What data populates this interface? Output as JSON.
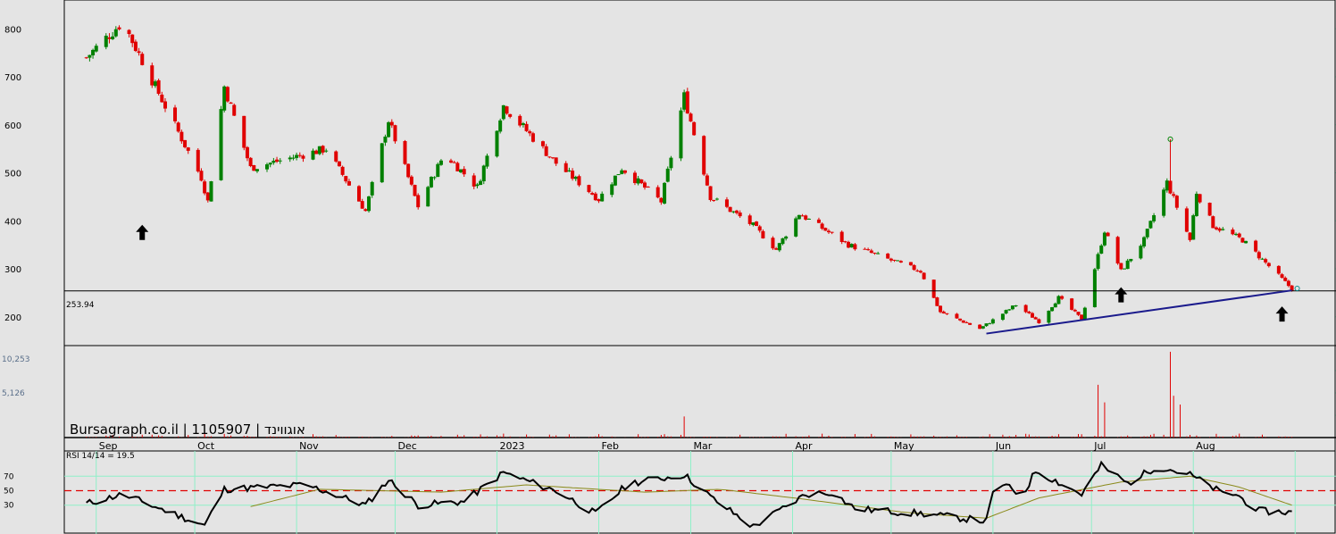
{
  "chart_data": {
    "type": "candlestick",
    "watermark": "Bursagraph.co.il | 1105907 | אוגווינד",
    "x_month_labels": [
      "Sep",
      "Oct",
      "Nov",
      "Dec",
      "2023",
      "Feb",
      "Mar",
      "Apr",
      "May",
      "Jun",
      "Jul",
      "Aug"
    ],
    "price_axis": {
      "ticks": [
        800,
        700,
        600,
        500,
        400,
        300,
        200
      ],
      "range": [
        140,
        860
      ]
    },
    "price_level_label": "253.94",
    "price_level": 253.94,
    "volume_axis": {
      "ticks": [
        "10,253",
        "5,126"
      ]
    },
    "rsi_label": "RSI 14/14 = 19.5",
    "rsi_axis": {
      "ticks": [
        70,
        50,
        30
      ],
      "reference_level": 50
    },
    "colors": {
      "up": "#008000",
      "down": "#e00000",
      "grid": "#8ff0c8",
      "trendline": "#1a1a8c",
      "rsi_ref": "#e00000",
      "rsi_line": "#000000",
      "rsi_signal": "#8a8a1a",
      "volume": "#e00000"
    },
    "trendline": {
      "from": {
        "date": "2023-05-30",
        "price": 165
      },
      "to": {
        "date": "2023-08-31",
        "price": 255
      }
    },
    "arrows": [
      {
        "date": "2022-09-15",
        "price": 375
      },
      {
        "date": "2023-07-10",
        "price": 245
      },
      {
        "date": "2023-08-28",
        "price": 205
      }
    ],
    "series": {
      "close_anchors": [
        {
          "date": "2022-08-29",
          "price": 740
        },
        {
          "date": "2022-09-09",
          "price": 815
        },
        {
          "date": "2022-10-03",
          "price": 490
        },
        {
          "date": "2022-10-05",
          "price": 440
        },
        {
          "date": "2022-10-10",
          "price": 680
        },
        {
          "date": "2022-10-18",
          "price": 510
        },
        {
          "date": "2022-11-10",
          "price": 550
        },
        {
          "date": "2022-11-22",
          "price": 420
        },
        {
          "date": "2022-11-29",
          "price": 610
        },
        {
          "date": "2022-12-08",
          "price": 430
        },
        {
          "date": "2022-12-16",
          "price": 540
        },
        {
          "date": "2022-12-26",
          "price": 470
        },
        {
          "date": "2023-01-03",
          "price": 640
        },
        {
          "date": "2023-01-19",
          "price": 520
        },
        {
          "date": "2023-02-01",
          "price": 445
        },
        {
          "date": "2023-02-08",
          "price": 510
        },
        {
          "date": "2023-02-20",
          "price": 440
        },
        {
          "date": "2023-02-27",
          "price": 660
        },
        {
          "date": "2023-03-07",
          "price": 450
        },
        {
          "date": "2023-03-20",
          "price": 390
        },
        {
          "date": "2023-03-27",
          "price": 340
        },
        {
          "date": "2023-04-03",
          "price": 415
        },
        {
          "date": "2023-04-18",
          "price": 350
        },
        {
          "date": "2023-05-10",
          "price": 295
        },
        {
          "date": "2023-05-16",
          "price": 210
        },
        {
          "date": "2023-05-28",
          "price": 175
        },
        {
          "date": "2023-06-08",
          "price": 225
        },
        {
          "date": "2023-06-15",
          "price": 190
        },
        {
          "date": "2023-06-21",
          "price": 240
        },
        {
          "date": "2023-06-28",
          "price": 195
        },
        {
          "date": "2023-07-05",
          "price": 380
        },
        {
          "date": "2023-07-10",
          "price": 295
        },
        {
          "date": "2023-07-17",
          "price": 360
        },
        {
          "date": "2023-07-24",
          "price": 480
        },
        {
          "date": "2023-07-31",
          "price": 360
        },
        {
          "date": "2023-08-02",
          "price": 460
        },
        {
          "date": "2023-08-07",
          "price": 390
        },
        {
          "date": "2023-08-16",
          "price": 360
        },
        {
          "date": "2023-08-31",
          "price": 258
        }
      ],
      "spike_high": {
        "date": "2023-07-25",
        "price": 570
      },
      "volume_spikes": [
        {
          "date": "2023-02-27",
          "volume": 4800
        },
        {
          "date": "2023-07-03",
          "volume": 12000
        },
        {
          "date": "2023-07-05",
          "volume": 8000
        },
        {
          "date": "2023-07-25",
          "volume": 19500
        },
        {
          "date": "2023-07-26",
          "volume": 9500
        },
        {
          "date": "2023-07-28",
          "volume": 7500
        }
      ]
    },
    "rsi": {
      "anchors": [
        {
          "date": "2022-08-29",
          "value": 32
        },
        {
          "date": "2022-09-09",
          "value": 45
        },
        {
          "date": "2022-10-04",
          "value": 2
        },
        {
          "date": "2022-10-10",
          "value": 52
        },
        {
          "date": "2022-11-04",
          "value": 58
        },
        {
          "date": "2022-11-22",
          "value": 30
        },
        {
          "date": "2022-11-29",
          "value": 65
        },
        {
          "date": "2022-12-08",
          "value": 30
        },
        {
          "date": "2022-12-22",
          "value": 35
        },
        {
          "date": "2023-01-03",
          "value": 75
        },
        {
          "date": "2023-01-20",
          "value": 48
        },
        {
          "date": "2023-01-31",
          "value": 18
        },
        {
          "date": "2023-02-10",
          "value": 60
        },
        {
          "date": "2023-02-27",
          "value": 72
        },
        {
          "date": "2023-03-08",
          "value": 38
        },
        {
          "date": "2023-03-20",
          "value": 0
        },
        {
          "date": "2023-04-05",
          "value": 45
        },
        {
          "date": "2023-04-13",
          "value": 48
        },
        {
          "date": "2023-04-20",
          "value": 25
        },
        {
          "date": "2023-05-11",
          "value": 18
        },
        {
          "date": "2023-05-30",
          "value": 8
        },
        {
          "date": "2023-06-02",
          "value": 65
        },
        {
          "date": "2023-06-10",
          "value": 42
        },
        {
          "date": "2023-06-14",
          "value": 78
        },
        {
          "date": "2023-06-28",
          "value": 45
        },
        {
          "date": "2023-07-04",
          "value": 85
        },
        {
          "date": "2023-07-12",
          "value": 60
        },
        {
          "date": "2023-07-21",
          "value": 84
        },
        {
          "date": "2023-07-31",
          "value": 72
        },
        {
          "date": "2023-08-10",
          "value": 46
        },
        {
          "date": "2023-08-14",
          "value": 45
        },
        {
          "date": "2023-08-21",
          "value": 22
        },
        {
          "date": "2023-08-31",
          "value": 20
        }
      ],
      "signal_anchors": [
        {
          "date": "2022-10-18",
          "value": 28
        },
        {
          "date": "2022-11-08",
          "value": 52
        },
        {
          "date": "2022-12-15",
          "value": 48
        },
        {
          "date": "2023-01-10",
          "value": 58
        },
        {
          "date": "2023-02-15",
          "value": 48
        },
        {
          "date": "2023-03-10",
          "value": 52
        },
        {
          "date": "2023-04-05",
          "value": 38
        },
        {
          "date": "2023-05-05",
          "value": 20
        },
        {
          "date": "2023-05-30",
          "value": 12
        },
        {
          "date": "2023-06-15",
          "value": 40
        },
        {
          "date": "2023-07-10",
          "value": 62
        },
        {
          "date": "2023-07-31",
          "value": 70
        },
        {
          "date": "2023-08-15",
          "value": 55
        },
        {
          "date": "2023-08-31",
          "value": 30
        }
      ]
    }
  }
}
